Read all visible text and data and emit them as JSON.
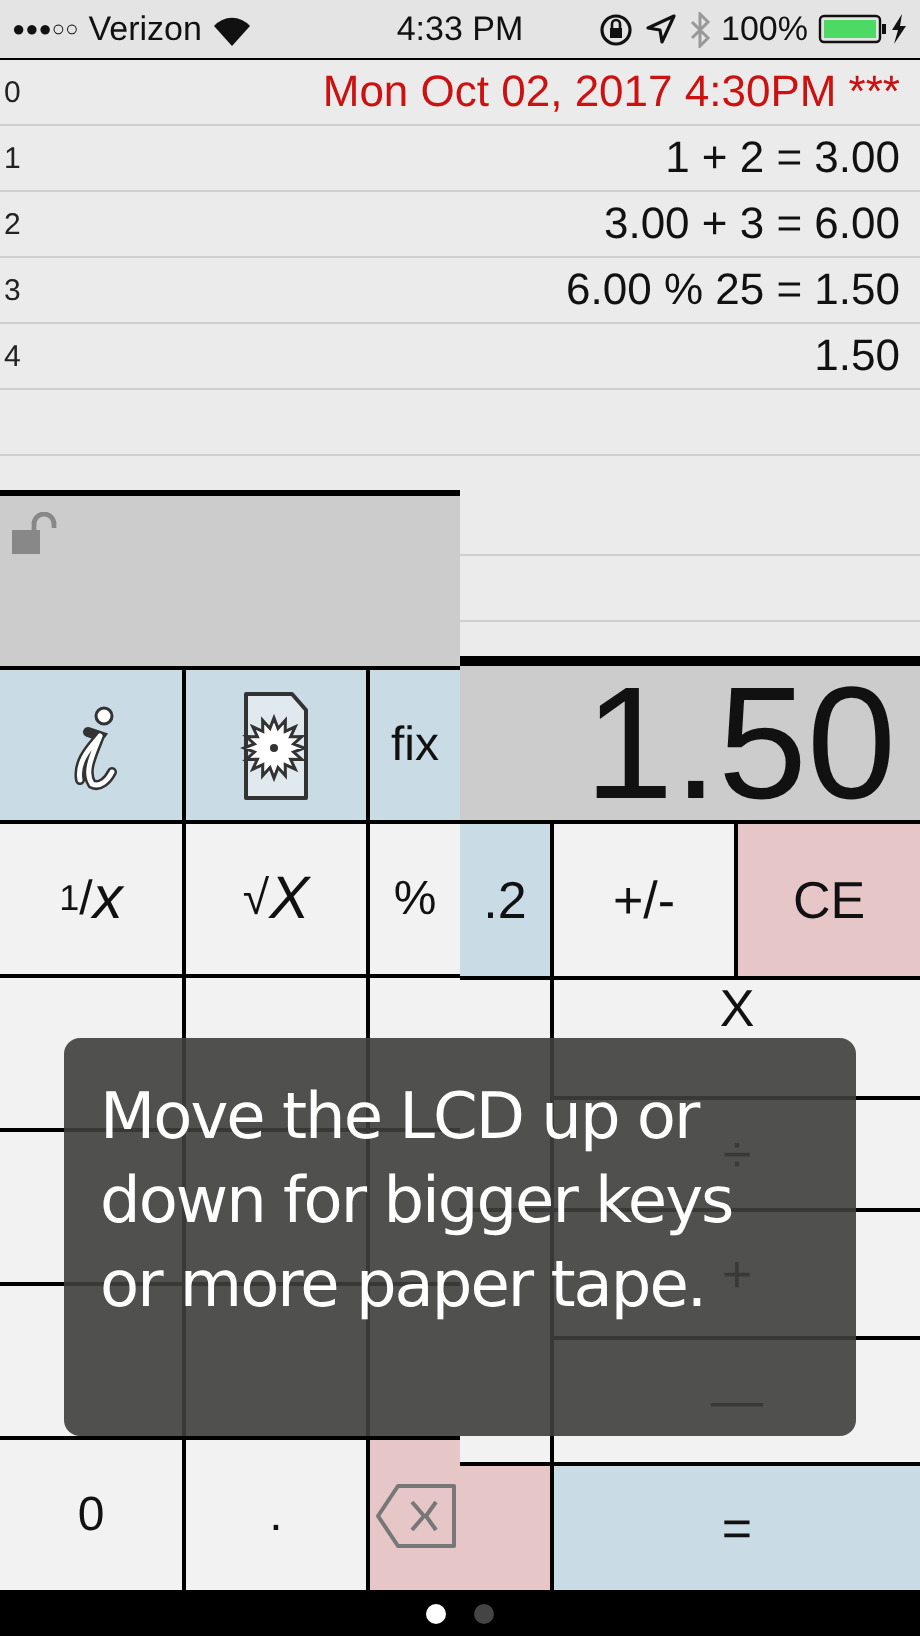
{
  "status_bar": {
    "signal": "●●●○○",
    "carrier": "Verizon",
    "time": "4:33 PM",
    "battery": "100%"
  },
  "tape": {
    "lines": [
      {
        "number": "0",
        "text": "Mon Oct 02, 2017 4:30PM ***",
        "kind": "timestamp"
      },
      {
        "number": "1",
        "text": "1 + 2 = 3.00",
        "kind": "entry"
      },
      {
        "number": "2",
        "text": "3.00 + 3 = 6.00",
        "kind": "entry"
      },
      {
        "number": "3",
        "text": "6.00 % 25 = 1.50",
        "kind": "entry"
      },
      {
        "number": "4",
        "text": "1.50",
        "kind": "entry"
      }
    ]
  },
  "left_panel": {
    "keys": [
      {
        "kind": "info"
      },
      {
        "kind": "settings"
      },
      {
        "kind": "function",
        "label": "fix"
      },
      {
        "kind": "digit",
        "label": "$^{1}$/*x*"
      },
      {
        "kind": "digit",
        "label": "√*X*"
      },
      {
        "kind": "digit",
        "label": "%"
      },
      {
        "kind": "digit"
      },
      {
        "kind": "digit"
      },
      {
        "kind": "digit"
      },
      {
        "kind": "digit"
      },
      {
        "kind": "digit"
      },
      {
        "kind": "digit"
      },
      {
        "kind": "digit"
      },
      {
        "kind": "digit"
      },
      {
        "kind": "digit"
      },
      {
        "kind": "digit",
        "label": "0"
      },
      {
        "kind": "digit",
        "label": "."
      },
      {
        "kind": "backspace"
      }
    ]
  },
  "right_panel": {
    "display": "1.50",
    "keys": [
      {
        "kind": "function",
        "label": ".2"
      },
      {
        "kind": "digit",
        "label": "+/-"
      },
      {
        "kind": "clear",
        "label": "CE"
      },
      {
        "kind": "digit"
      },
      {
        "kind": "digit",
        "label": "X"
      },
      {
        "kind": "digit",
        "label": "÷"
      },
      {
        "kind": "digit"
      },
      {
        "kind": "digit",
        "label": "+"
      },
      {
        "kind": "digit",
        "label": "—"
      },
      {
        "kind": "delete"
      },
      {
        "kind": "equals",
        "label": "="
      }
    ]
  },
  "overlay": {
    "message": "Move the LCD up or down for bigger keys or more paper tape."
  },
  "page_dots": [
    {
      "selected": true
    },
    {
      "selected": false
    }
  ]
}
